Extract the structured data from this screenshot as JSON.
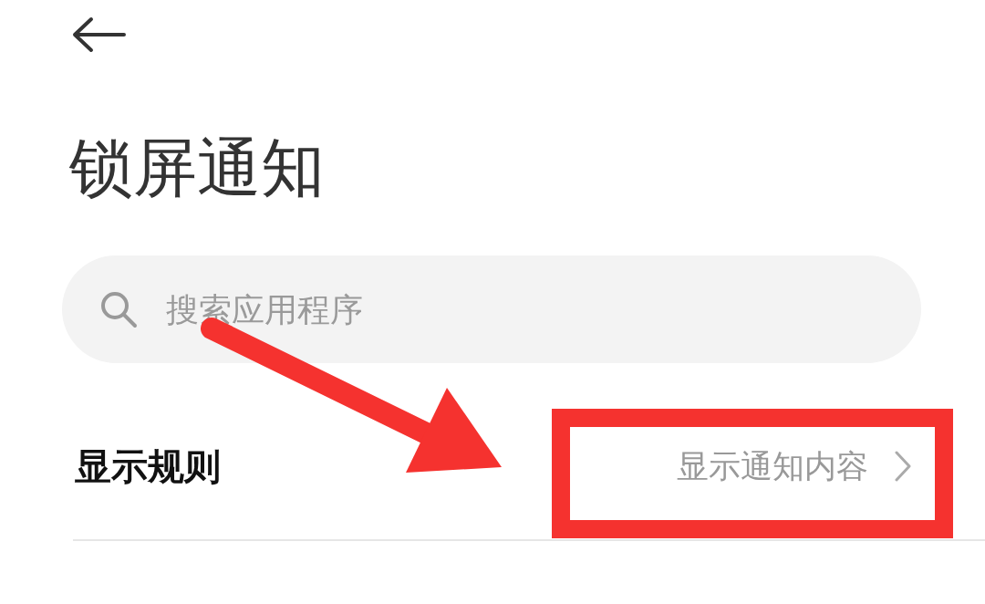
{
  "title": "锁屏通知",
  "search": {
    "placeholder": "搜索应用程序"
  },
  "rows": [
    {
      "label": "显示规则",
      "value": "显示通知内容"
    }
  ]
}
